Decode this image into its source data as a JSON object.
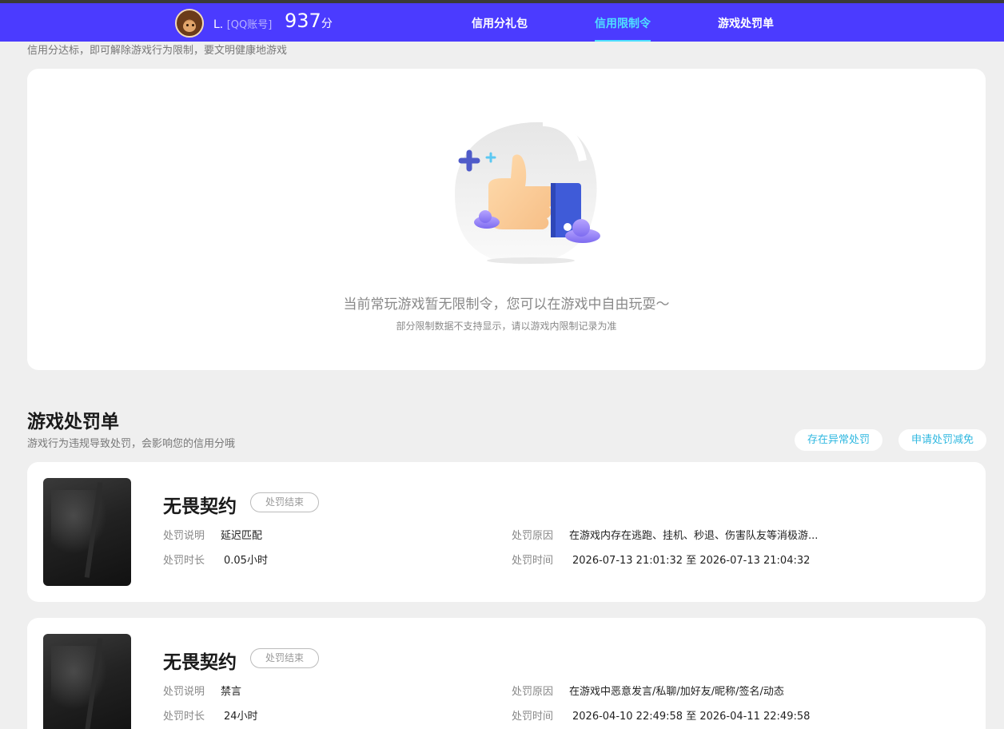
{
  "header": {
    "user_name": "L.",
    "user_tag": "[QQ账号]",
    "score": "937",
    "score_unit": "分",
    "nav": [
      "信用分礼包",
      "信用限制令",
      "游戏处罚单"
    ],
    "active_tab": "信用限制令"
  },
  "restriction": {
    "subtitle": "信用分达标，即可解除游戏行为限制，要文明健康地游戏",
    "empty_main": "当前常玩游戏暂无限制令，您可以在游戏中自由玩耍～",
    "empty_sub": "部分限制数据不支持显示，请以游戏内限制记录为准"
  },
  "penalty": {
    "title": "游戏处罚单",
    "subtitle": "游戏行为违规导致处罚，会影响您的信用分哦",
    "btn_abnormal": "存在异常处罚",
    "btn_reduce": "申请处罚减免",
    "labels": {
      "desc": "处罚说明",
      "duration": "处罚时长",
      "reason": "处罚原因",
      "time": "处罚时间"
    },
    "items": [
      {
        "game": "无畏契约",
        "status": "处罚结束",
        "desc": "延迟匹配",
        "duration": "0.05小时",
        "reason": "在游戏内存在逃跑、挂机、秒退、伤害队友等消极游...",
        "time": "2026-07-13 21:01:32 至 2026-07-13 21:04:32"
      },
      {
        "game": "无畏契约",
        "status": "处罚结束",
        "desc": "禁言",
        "duration": "24小时",
        "reason": "在游戏中恶意发言/私聊/加好友/昵称/签名/动态",
        "time": "2026-04-10 22:49:58 至 2026-04-11 22:49:58"
      }
    ]
  },
  "colors": {
    "header_bg": "#4b3bff",
    "active_tab": "#4fe0ff",
    "link": "#30b8e0",
    "page_bg": "#efefef"
  }
}
